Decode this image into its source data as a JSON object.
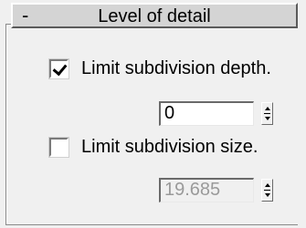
{
  "rollout": {
    "collapse_symbol": "-",
    "title": "Level of detail"
  },
  "options": [
    {
      "label": "Limit subdivision depth.",
      "checked": true,
      "spinner_value": "0",
      "spinner_enabled": true
    },
    {
      "label": "Limit subdivision size.",
      "checked": false,
      "spinner_value": "19.685",
      "spinner_enabled": false
    }
  ]
}
